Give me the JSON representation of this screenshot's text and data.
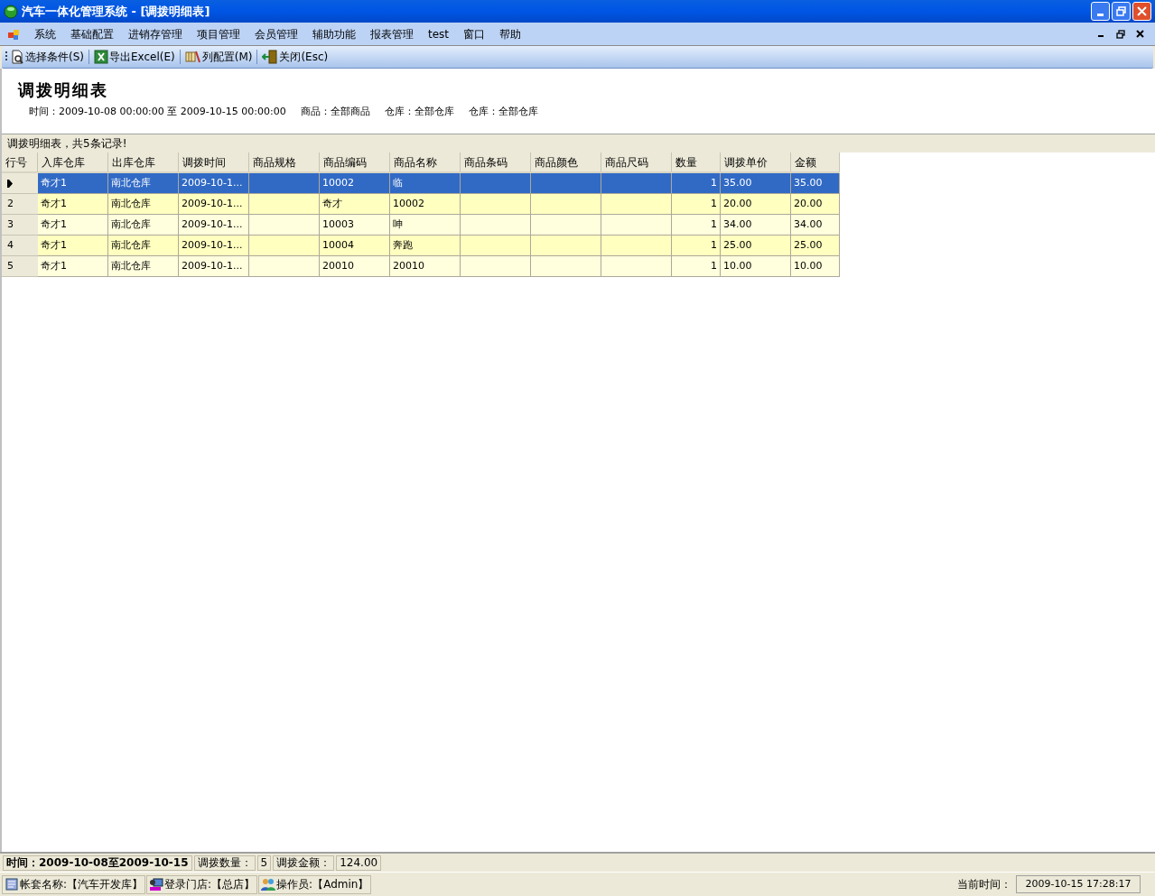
{
  "window": {
    "title": "汽车一体化管理系统 - [调拨明细表]"
  },
  "menu": [
    "系统",
    "基础配置",
    "进销存管理",
    "项目管理",
    "会员管理",
    "辅助功能",
    "报表管理",
    "test",
    "窗口",
    "帮助"
  ],
  "toolbar": [
    {
      "kind": "search",
      "label": "选择条件(S)"
    },
    {
      "kind": "excel",
      "label": "导出Excel(E)"
    },
    {
      "kind": "columns",
      "label": "列配置(M)"
    },
    {
      "kind": "exit",
      "label": "关闭(Esc)"
    }
  ],
  "report": {
    "title": "调拨明细表",
    "filters": [
      "时间：2009-10-08 00:00:00 至 2009-10-15 00:00:00",
      "商品：全部商品",
      "仓库：全部仓库",
      "仓库：全部仓库"
    ]
  },
  "grid_caption": "调拨明细表，共5条记录!",
  "table": {
    "columns": [
      "行号",
      "入库仓库",
      "出库仓库",
      "调拨时间",
      "商品规格",
      "商品编码",
      "商品名称",
      "商品条码",
      "商品颜色",
      "商品尺码",
      "数量",
      "调拨单价",
      "金额"
    ],
    "rows": [
      {
        "selected": true,
        "cells": [
          "",
          "奇才1",
          "南北仓库",
          "2009-10-1...",
          "",
          "10002",
          "临",
          "",
          "",
          "",
          "1",
          "35.00",
          "35.00"
        ]
      },
      {
        "selected": false,
        "cells": [
          "2",
          "奇才1",
          "南北仓库",
          "2009-10-1...",
          "",
          "奇才",
          "10002",
          "",
          "",
          "",
          "1",
          "20.00",
          "20.00"
        ]
      },
      {
        "selected": false,
        "cells": [
          "3",
          "奇才1",
          "南北仓库",
          "2009-10-1...",
          "",
          "10003",
          "呻",
          "",
          "",
          "",
          "1",
          "34.00",
          "34.00"
        ]
      },
      {
        "selected": false,
        "cells": [
          "4",
          "奇才1",
          "南北仓库",
          "2009-10-1...",
          "",
          "10004",
          "奔跑",
          "",
          "",
          "",
          "1",
          "25.00",
          "25.00"
        ]
      },
      {
        "selected": false,
        "cells": [
          "5",
          "奇才1",
          "南北仓库",
          "2009-10-1...",
          "",
          "20010",
          "20010",
          "",
          "",
          "",
          "1",
          "10.00",
          "10.00"
        ]
      }
    ]
  },
  "summary": [
    {
      "kind": "bold",
      "text": "时间：2009-10-08至2009-10-15"
    },
    {
      "kind": "label",
      "text": "调拨数量："
    },
    {
      "kind": "value",
      "text": "5"
    },
    {
      "kind": "label",
      "text": "调拨金额："
    },
    {
      "kind": "value",
      "text": "124.00"
    }
  ],
  "status_bar": {
    "items": [
      {
        "kind": "book",
        "text": "帐套名称:【汽车开发库】"
      },
      {
        "kind": "store",
        "text": "登录门店:【总店】"
      },
      {
        "kind": "users",
        "text": "操作员:【Admin】"
      }
    ],
    "time_label": "当前时间：",
    "time": "2009-10-15 17:28:17"
  }
}
